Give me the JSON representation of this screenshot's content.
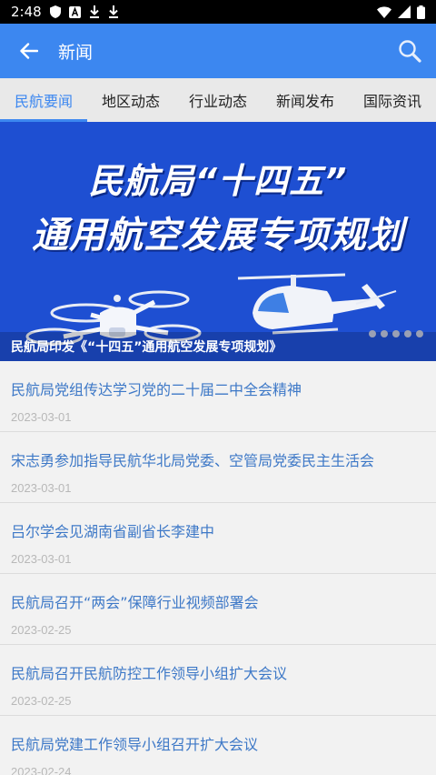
{
  "status_bar": {
    "time": "2:48",
    "icons": [
      "shield-icon",
      "a-box-icon",
      "download-icon",
      "download-icon",
      "wifi-icon",
      "signal-icon",
      "battery-icon"
    ]
  },
  "app_bar": {
    "title": "新闻",
    "back_icon": "arrow-left-icon",
    "search_icon": "search-icon"
  },
  "tabs": [
    {
      "label": "民航要闻",
      "active": true
    },
    {
      "label": "地区动态",
      "active": false
    },
    {
      "label": "行业动态",
      "active": false
    },
    {
      "label": "新闻发布",
      "active": false
    },
    {
      "label": "国际资讯",
      "active": false
    }
  ],
  "banner": {
    "line1": "民航局“十四五”",
    "line2": "通用航空发展专项规划",
    "caption": "民航局印发《“十四五”通用航空发展专项规划》",
    "dot_count": 5
  },
  "news": [
    {
      "title": "民航局党组传达学习党的二十届二中全会精神",
      "date": "2023-03-01"
    },
    {
      "title": "宋志勇参加指导民航华北局党委、空管局党委民主生活会",
      "date": "2023-03-01"
    },
    {
      "title": "吕尔学会见湖南省副省长李建中",
      "date": "2023-03-01"
    },
    {
      "title": "民航局召开“两会”保障行业视频部署会",
      "date": "2023-02-25"
    },
    {
      "title": "民航局召开民航防控工作领导小组扩大会议",
      "date": "2023-02-25"
    },
    {
      "title": "民航局党建工作领导小组召开扩大会议",
      "date": "2023-02-24"
    }
  ],
  "colors": {
    "app_bar": "#3c87f0",
    "tab_active": "#3c87f0",
    "banner_bg": "#1e4fd2",
    "news_title": "#3d78c7",
    "news_date": "#b8b8b8"
  }
}
